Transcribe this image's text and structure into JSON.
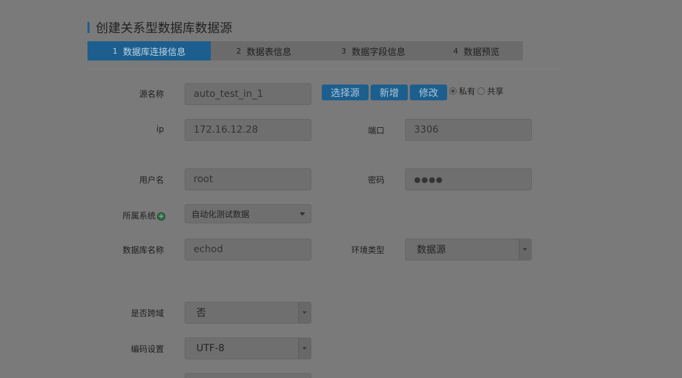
{
  "page": {
    "title": "创建关系型数据库数据源"
  },
  "steps": [
    {
      "num": "1",
      "label": "数据库连接信息",
      "active": true
    },
    {
      "num": "2",
      "label": "数据表信息",
      "active": false
    },
    {
      "num": "3",
      "label": "数据字段信息",
      "active": false
    },
    {
      "num": "4",
      "label": "数据预览",
      "active": false
    }
  ],
  "form": {
    "source_name": {
      "label": "源名称",
      "value": "auto_test_in_1"
    },
    "buttons": {
      "select_source": "选择源",
      "add": "新增",
      "edit": "修改"
    },
    "visibility": {
      "private_label": "私有",
      "shared_label": "共享",
      "selected": "私有"
    },
    "ip": {
      "label": "ip",
      "value": "172.16.12.28"
    },
    "port": {
      "label": "端口",
      "value": "3306"
    },
    "username": {
      "label": "用户名",
      "value": "root"
    },
    "password": {
      "label": "密码",
      "value": "●●●●"
    },
    "system": {
      "label": "所属系统",
      "value": "自动化测试数据"
    },
    "db_name": {
      "label": "数据库名称",
      "value": "echod"
    },
    "env_type": {
      "label": "环境类型",
      "value": "数据源"
    },
    "cross_domain": {
      "label": "是否跨域",
      "value": "否"
    },
    "encoding": {
      "label": "编码设置",
      "value": "UTF-8"
    }
  }
}
